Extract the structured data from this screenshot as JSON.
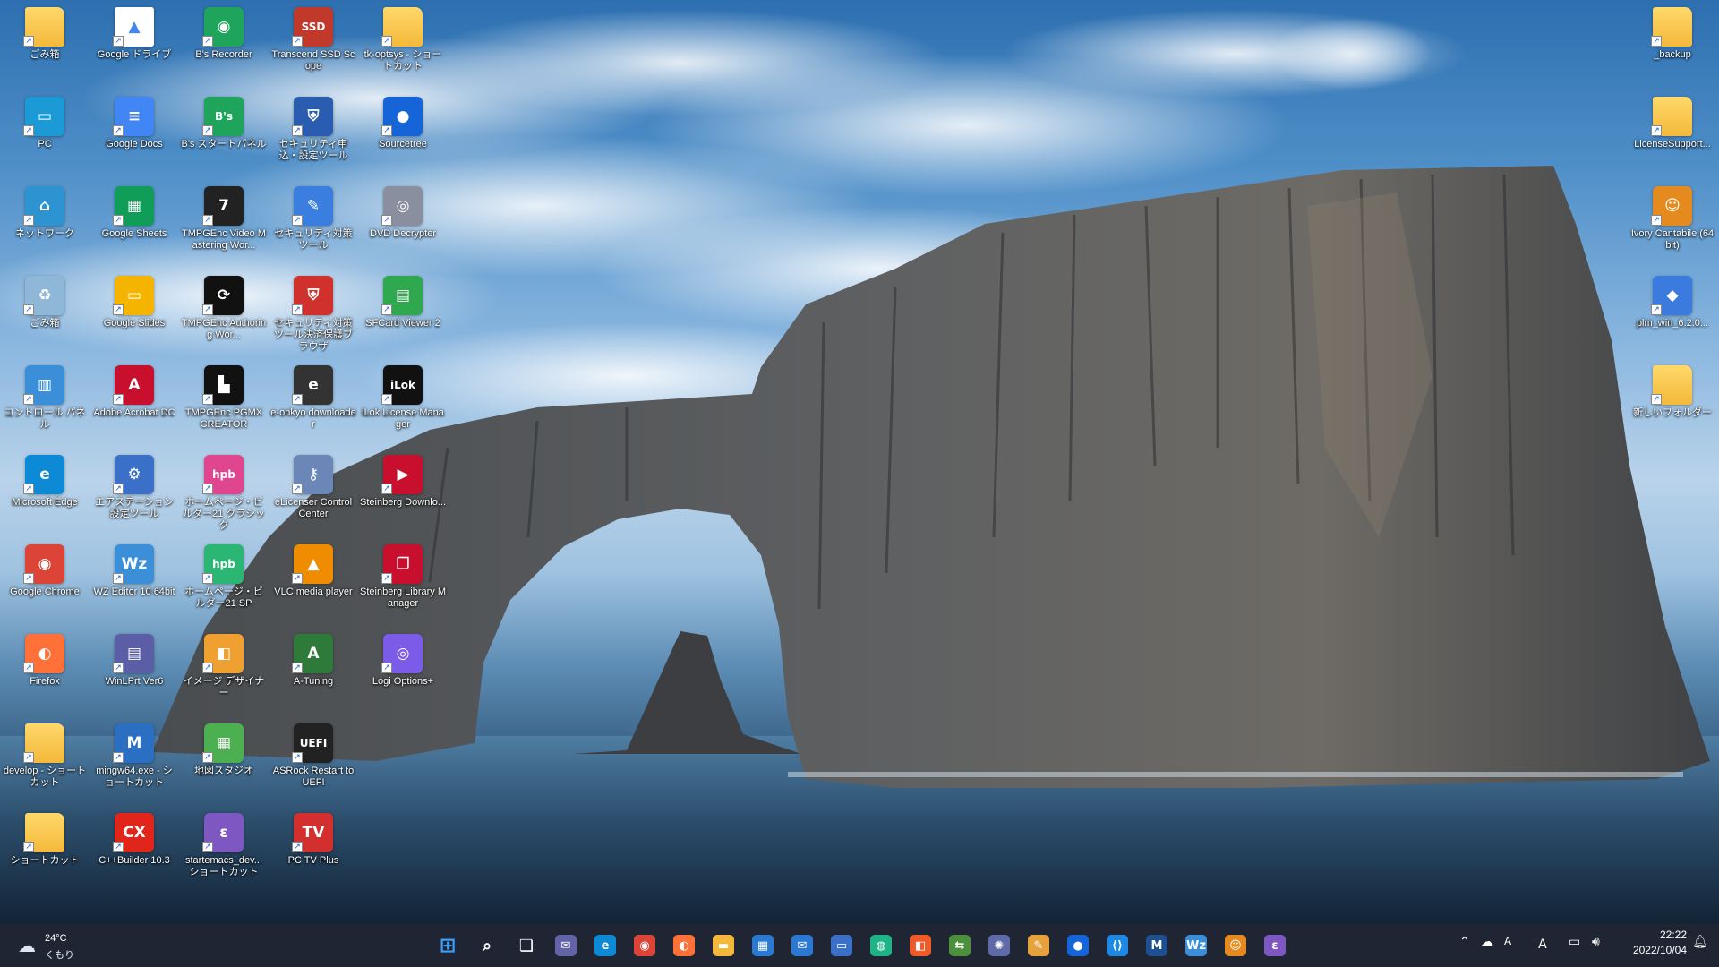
{
  "desktop": {
    "icons": [
      {
        "label": "ごみ箱",
        "kind": "folder",
        "glyph": ""
      },
      {
        "label": "Google ドライブ",
        "kind": "doc",
        "glyph": "▲"
      },
      {
        "label": "B's Recorder",
        "kind": "app",
        "glyph": "◉",
        "color": "#1fa45b"
      },
      {
        "label": "Transcend SSD Scope",
        "kind": "app",
        "glyph": "SSD",
        "color": "#c0392b"
      },
      {
        "label": "tk-optsys - ショートカット",
        "kind": "folder",
        "glyph": ""
      },
      {
        "label": "_backup",
        "kind": "folder",
        "glyph": ""
      },
      {
        "label": "PC",
        "kind": "app",
        "glyph": "▭",
        "color": "#1c9ad6"
      },
      {
        "label": "Google Docs",
        "kind": "app",
        "glyph": "≡",
        "color": "#4285f4"
      },
      {
        "label": "B's スタートパネル",
        "kind": "app",
        "glyph": "B's",
        "color": "#1fa45b"
      },
      {
        "label": "セキュリティ申込・設定ツール",
        "kind": "app",
        "glyph": "⛨",
        "color": "#2a5db0"
      },
      {
        "label": "Sourcetree",
        "kind": "app",
        "glyph": "●",
        "color": "#1565d8"
      },
      {
        "label": "LicenseSupport...",
        "kind": "folder",
        "glyph": ""
      },
      {
        "label": "ネットワーク",
        "kind": "app",
        "glyph": "⌂",
        "color": "#2e93d1"
      },
      {
        "label": "Google Sheets",
        "kind": "app",
        "glyph": "▦",
        "color": "#0f9d58"
      },
      {
        "label": "TMPGEnc Video Mastering Wor...",
        "kind": "app",
        "glyph": "7",
        "color": "#222222"
      },
      {
        "label": "セキュリティ対策ツール",
        "kind": "app",
        "glyph": "✎",
        "color": "#3a7fe0"
      },
      {
        "label": "DVD Decrypter",
        "kind": "app",
        "glyph": "◎",
        "color": "#8a8fa0"
      },
      {
        "label": "Ivory Cantabile (64bit)",
        "kind": "app",
        "glyph": "☺",
        "color": "#e58a1f"
      },
      {
        "label": "ごみ箱",
        "kind": "app",
        "glyph": "♻",
        "color": "#8fb7d8"
      },
      {
        "label": "Google Slides",
        "kind": "app",
        "glyph": "▭",
        "color": "#f4b400"
      },
      {
        "label": "TMPGEnc Authoring Wor...",
        "kind": "app",
        "glyph": "⟳",
        "color": "#111111"
      },
      {
        "label": "セキュリティ対策ツール決済保護ブラウザ",
        "kind": "app",
        "glyph": "⛨",
        "color": "#d0312d"
      },
      {
        "label": "SFCard Viewer 2",
        "kind": "app",
        "glyph": "▤",
        "color": "#2fa84f"
      },
      {
        "label": "plm_win_6.2.0...",
        "kind": "app",
        "glyph": "◆",
        "color": "#3b7be0"
      },
      {
        "label": "コントロール パネル",
        "kind": "app",
        "glyph": "▥",
        "color": "#3a8fd8"
      },
      {
        "label": "Adobe Acrobat DC",
        "kind": "app",
        "glyph": "A",
        "color": "#c8102e"
      },
      {
        "label": "TMPGEnc PGMX CREATOR",
        "kind": "app",
        "glyph": "▙",
        "color": "#111111"
      },
      {
        "label": "e-onkyo downloader",
        "kind": "app",
        "glyph": "e",
        "color": "#333333"
      },
      {
        "label": "iLok License Manager",
        "kind": "app",
        "glyph": "iLok",
        "color": "#111111"
      },
      {
        "label": "新しいフォルダー",
        "kind": "folder",
        "glyph": ""
      },
      {
        "label": "Microsoft Edge",
        "kind": "app",
        "glyph": "e",
        "color": "#0c8ad6"
      },
      {
        "label": "エアステーション設定ツール",
        "kind": "app",
        "glyph": "⚙",
        "color": "#3a70c8"
      },
      {
        "label": "ホームページ・ビルダー21 クラシック",
        "kind": "app",
        "glyph": "hpb",
        "color": "#e0458f"
      },
      {
        "label": "eLicenser Control Center",
        "kind": "app",
        "glyph": "⚷",
        "color": "#6a87b8"
      },
      {
        "label": "Steinberg Downlo...",
        "kind": "app",
        "glyph": "▶",
        "color": "#c8102e"
      },
      {
        "label": "Google Chrome",
        "kind": "app",
        "glyph": "◉",
        "color": "#db4437"
      },
      {
        "label": "WZ Editor 10 64bit",
        "kind": "app",
        "glyph": "Wz",
        "color": "#3b8fd9"
      },
      {
        "label": "ホームページ・ビルダー21 SP",
        "kind": "app",
        "glyph": "hpb",
        "color": "#2bb673"
      },
      {
        "label": "VLC media player",
        "kind": "app",
        "glyph": "▲",
        "color": "#f08c00"
      },
      {
        "label": "Steinberg Library Manager",
        "kind": "app",
        "glyph": "❐",
        "color": "#c8102e"
      },
      {
        "label": "Firefox",
        "kind": "app",
        "glyph": "◐",
        "color": "#ff7139"
      },
      {
        "label": "WinLPrt Ver6",
        "kind": "app",
        "glyph": "▤",
        "color": "#5b5ea6"
      },
      {
        "label": "イメージ デザイナー",
        "kind": "app",
        "glyph": "◧",
        "color": "#f0a030"
      },
      {
        "label": "A-Tuning",
        "kind": "app",
        "glyph": "A",
        "color": "#2d7a3a"
      },
      {
        "label": "Logi Options+",
        "kind": "app",
        "glyph": "◎",
        "color": "#7b5ce8"
      },
      {
        "label": "develop - ショートカット",
        "kind": "folder",
        "glyph": ""
      },
      {
        "label": "mingw64.exe - ショートカット",
        "kind": "app",
        "glyph": "M",
        "color": "#2a6fc2"
      },
      {
        "label": "地図スタジオ",
        "kind": "app",
        "glyph": "▦",
        "color": "#4caf50"
      },
      {
        "label": "ASRock Restart to UEFI",
        "kind": "app",
        "glyph": "UEFI",
        "color": "#222222"
      },
      {
        "label": "ショートカット",
        "kind": "folder",
        "glyph": ""
      },
      {
        "label": "C++Builder 10.3",
        "kind": "app",
        "glyph": "CX",
        "color": "#e1251b"
      },
      {
        "label": "startemacs_dev... ショートカット",
        "kind": "app",
        "glyph": "ε",
        "color": "#7e57c2"
      },
      {
        "label": "PC TV Plus",
        "kind": "app",
        "glyph": "TV",
        "color": "#d32f2f"
      }
    ]
  },
  "taskbar": {
    "weather": {
      "temp": "24°C",
      "condition": "くもり",
      "icon": "cloud-icon"
    },
    "apps": [
      {
        "name": "start-button",
        "glyph": "⊞",
        "color": "#3aa0ff"
      },
      {
        "name": "search-button",
        "glyph": "⌕",
        "color": "#ffffff"
      },
      {
        "name": "task-view-button",
        "glyph": "❏",
        "color": "#ffffff"
      },
      {
        "name": "teams-chat-button",
        "glyph": "✉",
        "color": "#6264a7"
      },
      {
        "name": "edge-taskbar",
        "glyph": "e",
        "color": "#0c8ad6"
      },
      {
        "name": "chrome-taskbar",
        "glyph": "◉",
        "color": "#db4437"
      },
      {
        "name": "firefox-taskbar",
        "glyph": "◐",
        "color": "#ff7139"
      },
      {
        "name": "file-explorer-taskbar",
        "glyph": "▬",
        "color": "#f4b93a"
      },
      {
        "name": "store-taskbar",
        "glyph": "▦",
        "color": "#2b79d0"
      },
      {
        "name": "mail-taskbar",
        "glyph": "✉",
        "color": "#2b79d0"
      },
      {
        "name": "remote-taskbar",
        "glyph": "▭",
        "color": "#3a70c8"
      },
      {
        "name": "app-green-taskbar",
        "glyph": "◍",
        "color": "#1fb487"
      },
      {
        "name": "app-orange-taskbar",
        "glyph": "◧",
        "color": "#f05a28"
      },
      {
        "name": "app-connect-taskbar",
        "glyph": "⇆",
        "color": "#4c8f3c"
      },
      {
        "name": "app-settings-taskbar",
        "glyph": "✺",
        "color": "#5f6aa8"
      },
      {
        "name": "app-tools-taskbar",
        "glyph": "✎",
        "color": "#e6a23c"
      },
      {
        "name": "sourcetree-taskbar",
        "glyph": "●",
        "color": "#1565d8"
      },
      {
        "name": "vscode-taskbar",
        "glyph": "⟨⟩",
        "color": "#1e88e5"
      },
      {
        "name": "m-app-taskbar",
        "glyph": "M",
        "color": "#1d4f91"
      },
      {
        "name": "wz-editor-taskbar",
        "glyph": "Wz",
        "color": "#3b8fd9"
      },
      {
        "name": "ivory-taskbar",
        "glyph": "☺",
        "color": "#e58a1f"
      },
      {
        "name": "emacs-taskbar",
        "glyph": "ε",
        "color": "#7e57c2"
      }
    ],
    "tray": {
      "ime_label": "A",
      "time": "22:22",
      "date": "2022/10/04"
    }
  }
}
